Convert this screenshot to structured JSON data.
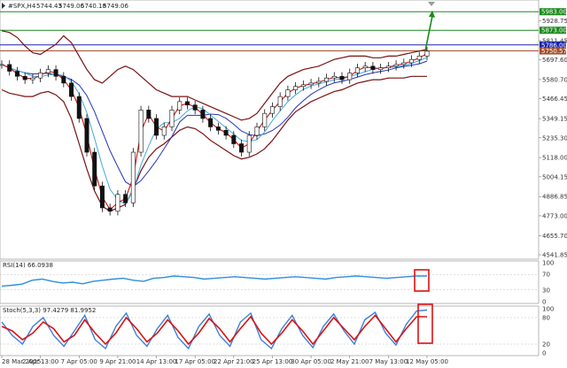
{
  "header": {
    "symbol": "#SPX,H4",
    "open": "5744.43",
    "high": "5749.06",
    "low": "5740.18",
    "close": "5749.06"
  },
  "colors": {
    "bollinger": "#7a1010",
    "ma_fast": "#cc1111",
    "ma_slow": "#2233bb",
    "ma_mid": "#44aadd",
    "candle": "#111111",
    "rsi_line": "#2e8ede",
    "stoch_main": "#3b7fd6",
    "stoch_signal": "#dd1111",
    "level_green": "#1a8a1a",
    "level_blue": "#1a22aa",
    "level_brown": "#a05030",
    "arrow": "#1a8a1a",
    "highlight_box": "#dd1111"
  },
  "price_axis": {
    "ticks": [
      "5983.00",
      "5928.75",
      "5873.00",
      "5811.45",
      "5786.00",
      "5750.57",
      "5697.60",
      "5580.70",
      "5466.45",
      "5349.15",
      "5235.30",
      "5118.00",
      "5004.15",
      "4886.85",
      "4773.00",
      "4655.70",
      "4541.85"
    ]
  },
  "levels": [
    {
      "label": "5983.00",
      "value": 5983.0,
      "color": "#1a8a1a"
    },
    {
      "label": "5873.00",
      "value": 5873.0,
      "color": "#1a8a1a"
    },
    {
      "label": "5786.00",
      "value": 5786.0,
      "color": "#1a22aa"
    },
    {
      "label": "5750.57",
      "value": 5750.57,
      "color": "#a05030"
    }
  ],
  "rsi": {
    "label": "RSI(14) 66.0938",
    "axis_ticks": [
      "100",
      "70",
      "30",
      "0"
    ]
  },
  "stoch": {
    "label": "Stoch(5,3,3) 97.4279 81.9952",
    "axis_ticks": [
      "100",
      "80",
      "20",
      "0"
    ]
  },
  "time_axis": {
    "labels": [
      "28 Mar 2025",
      "2 Apr 13:00",
      "7 Apr 05:00",
      "9 Apr 21:00",
      "14 Apr 13:00",
      "17 Apr 05:00",
      "22 Apr 21:00",
      "25 Apr 13:00",
      "30 Apr 05:00",
      "2 May 21:00",
      "7 May 13:00",
      "12 May 05:00"
    ]
  },
  "chart_data": {
    "type": "line",
    "x_range": [
      "28 Mar 2025",
      "12 May 05:00"
    ],
    "ylim": [
      4541.85,
      6000
    ],
    "series": [
      {
        "role": "price_close",
        "values": [
          5670,
          5630,
          5600,
          5580,
          5590,
          5620,
          5640,
          5600,
          5560,
          5480,
          5350,
          5150,
          4950,
          4820,
          4800,
          4900,
          4850,
          5150,
          5400,
          5350,
          5250,
          5300,
          5400,
          5450,
          5430,
          5400,
          5350,
          5300,
          5280,
          5250,
          5200,
          5150,
          5250,
          5300,
          5380,
          5420,
          5480,
          5520,
          5540,
          5550,
          5560,
          5570,
          5590,
          5600,
          5580,
          5620,
          5650,
          5660,
          5640,
          5650,
          5660,
          5670,
          5680,
          5700,
          5720,
          5749
        ]
      },
      {
        "role": "bollinger_upper",
        "values": [
          5870,
          5860,
          5830,
          5780,
          5740,
          5730,
          5760,
          5790,
          5840,
          5800,
          5720,
          5640,
          5580,
          5560,
          5600,
          5640,
          5660,
          5640,
          5600,
          5560,
          5520,
          5500,
          5480,
          5480,
          5480,
          5460,
          5440,
          5420,
          5400,
          5380,
          5360,
          5340,
          5350,
          5380,
          5440,
          5500,
          5560,
          5600,
          5620,
          5640,
          5650,
          5660,
          5680,
          5700,
          5710,
          5720,
          5720,
          5720,
          5710,
          5710,
          5720,
          5720,
          5730,
          5740,
          5750,
          5760
        ]
      },
      {
        "role": "bollinger_lower",
        "values": [
          5520,
          5500,
          5490,
          5480,
          5480,
          5500,
          5510,
          5490,
          5450,
          5350,
          5200,
          5050,
          4920,
          4830,
          4800,
          4820,
          4840,
          4930,
          5040,
          5120,
          5170,
          5200,
          5240,
          5280,
          5300,
          5290,
          5260,
          5220,
          5190,
          5160,
          5130,
          5110,
          5120,
          5140,
          5170,
          5220,
          5280,
          5340,
          5390,
          5420,
          5450,
          5470,
          5490,
          5510,
          5520,
          5540,
          5560,
          5570,
          5580,
          5580,
          5590,
          5590,
          5590,
          5600,
          5600,
          5600
        ]
      },
      {
        "role": "rsi",
        "values": [
          40,
          42,
          45,
          55,
          58,
          52,
          48,
          50,
          46,
          52,
          55,
          58,
          60,
          55,
          52,
          60,
          62,
          66,
          64,
          62,
          58,
          60,
          62,
          64,
          62,
          60,
          58,
          60,
          62,
          64,
          62,
          60,
          58,
          62,
          64,
          66,
          64,
          62,
          60,
          62,
          64,
          66,
          66
        ]
      },
      {
        "role": "stoch_main",
        "values": [
          70,
          40,
          20,
          60,
          80,
          40,
          15,
          50,
          85,
          30,
          10,
          60,
          90,
          40,
          15,
          55,
          85,
          35,
          10,
          60,
          88,
          40,
          15,
          70,
          90,
          30,
          10,
          55,
          85,
          40,
          12,
          60,
          88,
          50,
          20,
          75,
          92,
          45,
          18,
          65,
          95,
          97
        ]
      },
      {
        "role": "stoch_signal",
        "values": [
          60,
          50,
          30,
          45,
          70,
          55,
          25,
          40,
          75,
          45,
          20,
          45,
          80,
          55,
          25,
          45,
          75,
          50,
          20,
          45,
          78,
          55,
          25,
          55,
          82,
          45,
          20,
          45,
          75,
          50,
          20,
          50,
          80,
          55,
          30,
          60,
          85,
          55,
          25,
          55,
          82,
          82
        ]
      }
    ]
  }
}
